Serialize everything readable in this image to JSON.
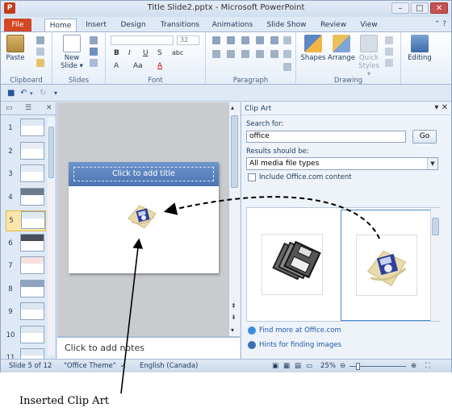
{
  "window": {
    "title": "Title Slide2.pptx - Microsoft PowerPoint"
  },
  "tabs": [
    {
      "label": "File"
    },
    {
      "label": "Home"
    },
    {
      "label": "Insert"
    },
    {
      "label": "Design"
    },
    {
      "label": "Transitions"
    },
    {
      "label": "Animations"
    },
    {
      "label": "Slide Show"
    },
    {
      "label": "Review"
    },
    {
      "label": "View"
    }
  ],
  "ribbon": {
    "clipboard": {
      "label": "Clipboard",
      "paste": "Paste"
    },
    "slides": {
      "label": "Slides",
      "new_slide": "New",
      "new_slide2": "Slide ▾"
    },
    "font": {
      "label": "Font",
      "size": "32",
      "bold": "B",
      "italic": "I",
      "underline": "U",
      "strike": "S",
      "shadow": "abc",
      "grow": "A",
      "shrink": "Aa",
      "color": "A"
    },
    "paragraph": {
      "label": "Paragraph"
    },
    "drawing": {
      "label": "Drawing",
      "shapes": "Shapes",
      "arrange": "Arrange",
      "quick_styles": "Quick",
      "quick_styles2": "Styles ▾"
    },
    "editing": {
      "label": "Editing"
    }
  },
  "thumbnails": [
    {
      "num": "1"
    },
    {
      "num": "2"
    },
    {
      "num": "3"
    },
    {
      "num": "4"
    },
    {
      "num": "5"
    },
    {
      "num": "6"
    },
    {
      "num": "7"
    },
    {
      "num": "8"
    },
    {
      "num": "9"
    },
    {
      "num": "10"
    },
    {
      "num": "11"
    }
  ],
  "selected_slide": 5,
  "slide": {
    "title_placeholder": "Click to add title"
  },
  "notes": {
    "placeholder": "Click to add notes"
  },
  "clip_art": {
    "pane_title": "Clip Art",
    "search_label": "Search for:",
    "search_value": "office",
    "go_label": "Go",
    "results_label": "Results should be:",
    "media_type": "All media file types",
    "include_office": "Include Office.com content",
    "find_more": "Find more at Office.com",
    "hints": "Hints for finding images"
  },
  "status": {
    "slide_of": "Slide 5 of 12",
    "theme": "\"Office Theme\"",
    "language": "English (Canada)",
    "zoom": "25%"
  },
  "annotation": {
    "caption": "Inserted Clip Art"
  }
}
